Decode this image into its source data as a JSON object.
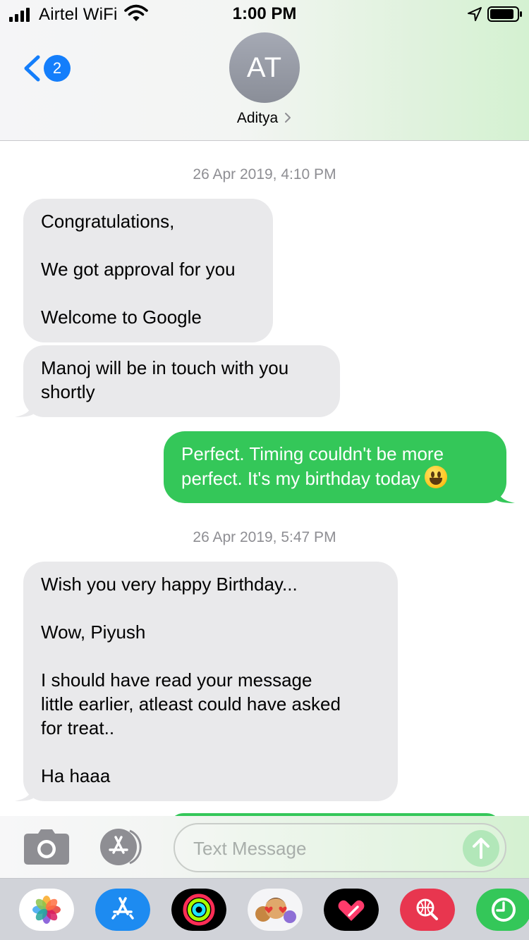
{
  "status_bar": {
    "carrier": "Airtel WiFi",
    "time": "1:00 PM",
    "icons": [
      "signal-icon",
      "wifi-icon",
      "location-icon",
      "battery-icon"
    ]
  },
  "header": {
    "back_badge_count": "2",
    "avatar_initials": "AT",
    "contact_name": "Aditya",
    "icons": [
      "back-chevron-icon",
      "contact-chevron-icon"
    ]
  },
  "conversation": {
    "groups": [
      {
        "timestamp": "26 Apr 2019, 4:10 PM",
        "messages": [
          {
            "direction": "received",
            "paragraphs": [
              [
                "Congratulations,"
              ],
              [
                "We got approval for you"
              ],
              [
                "Welcome to Google"
              ]
            ]
          },
          {
            "direction": "received",
            "paragraphs": [
              [
                "Manoj will be in touch with you",
                "shortly"
              ]
            ]
          },
          {
            "direction": "sent",
            "paragraphs": [
              [
                "Perfect. Timing couldn't be more",
                "perfect. It's my birthday today"
              ]
            ],
            "emoji": "grinning-face-emoji"
          }
        ]
      },
      {
        "timestamp": "26 Apr 2019, 5:47 PM",
        "messages": [
          {
            "direction": "received",
            "paragraphs": [
              [
                "Wish you very happy Birthday..."
              ],
              [
                "Wow, Piyush"
              ],
              [
                "I should have read your message",
                "little earlier, atleast could have asked",
                "for treat.."
              ],
              [
                "Ha haaa"
              ]
            ]
          }
        ]
      }
    ]
  },
  "compose": {
    "placeholder": "Text Message",
    "value": "",
    "icons": [
      "camera-icon",
      "app-store-icon",
      "send-arrow-icon"
    ]
  },
  "app_drawer": {
    "apps": [
      "photos-app-icon",
      "app-store-app-icon",
      "activity-app-icon",
      "memoji-app-icon",
      "digital-touch-app-icon",
      "web-search-app-icon",
      "recents-app-icon"
    ]
  },
  "colors": {
    "imessage_blue": "#147efb",
    "sent_bubble": "#34c759",
    "received_bubble": "#e9e9eb",
    "timestamp_gray": "#8e8e93"
  }
}
